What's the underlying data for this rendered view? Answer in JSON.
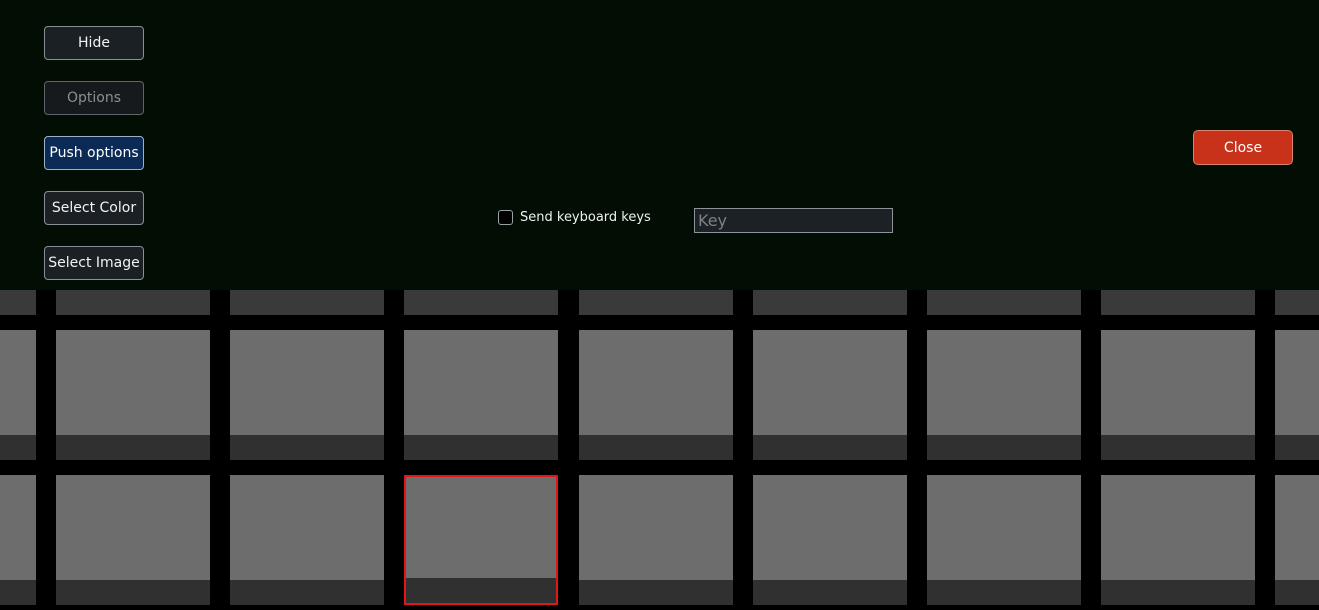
{
  "panel": {
    "buttons": {
      "hide": "Hide",
      "options": "Options",
      "push_options": "Push options",
      "select_color": "Select Color",
      "select_image": "Select Image",
      "close": "Close"
    },
    "keyboard": {
      "checkbox_label": "Send keyboard keys",
      "checked": false,
      "key_placeholder": "Key",
      "key_value": ""
    }
  },
  "colors": {
    "panel_bg": "#020d03",
    "close_button": "#c8321a",
    "push_button": "#0b2a55",
    "tile": "#6d6d6d",
    "tile_bar": "#303030",
    "selected_border": "#e0161a"
  },
  "grid": {
    "visible_rows": 3,
    "visible_columns": 9,
    "selected": {
      "row": 3,
      "column": 4
    }
  }
}
